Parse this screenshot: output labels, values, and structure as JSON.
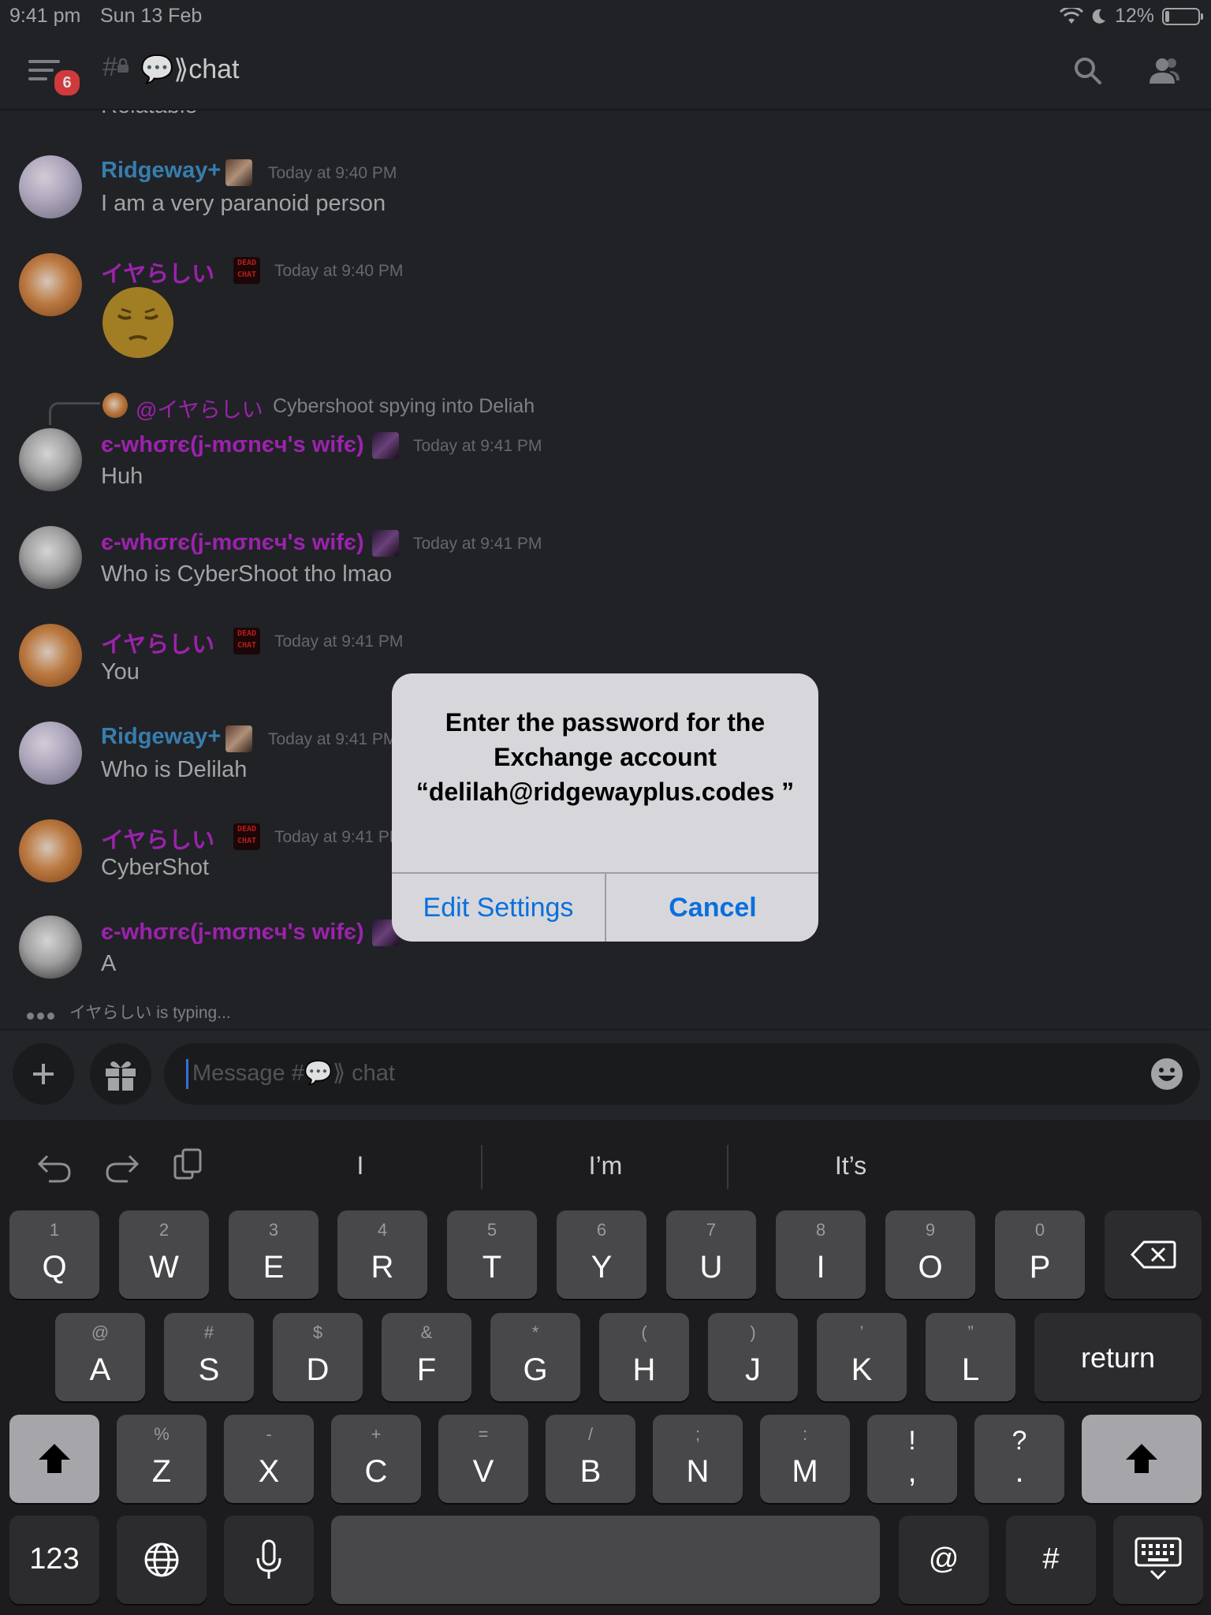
{
  "status_bar": {
    "time": "9:41 pm",
    "date": "Sun 13 Feb",
    "battery_text": "12%",
    "battery_level": 0.12
  },
  "header": {
    "badge_count": "6",
    "channel_name": "💬⟫chat"
  },
  "messages_partial_top": "Relatable",
  "messages": [
    {
      "username": "Ridgeway+",
      "timestamp": "Today at 9:40 PM",
      "text": "I am a very paranoid person"
    },
    {
      "username": "イヤらしい",
      "timestamp": "Today at 9:40 PM",
      "text": "😔"
    },
    {
      "reply_to": "@イヤらしい",
      "reply_text": "Cybershoot spying into Deliah",
      "username": "є-whσrє(j-mσnєч's wifє)",
      "timestamp": "Today at 9:41 PM",
      "text": "Huh"
    },
    {
      "username": "є-whσrє(j-mσnєч's wifє)",
      "timestamp": "Today at 9:41 PM",
      "text": "Who is CyberShoot tho lmao"
    },
    {
      "username": "イヤらしい",
      "timestamp": "Today at 9:41 PM",
      "text": "You"
    },
    {
      "username": "Ridgeway+",
      "timestamp": "Today at 9:41 PM",
      "text": "Who is Delilah"
    },
    {
      "username": "イヤらしい",
      "timestamp": "Today at 9:41 PM",
      "text": "CyberShot"
    },
    {
      "username": "є-whσrє(j-mσnєч's wifє)",
      "timestamp": "",
      "text": "A"
    }
  ],
  "role_badge_text": "DEAD CHAT",
  "typing": {
    "text": "イヤらしい is typing..."
  },
  "composer": {
    "placeholder": "Message #💬⟫ chat"
  },
  "alert": {
    "title": "Enter the password for the Exchange account “delilah@ridgewayplus.codes ”",
    "edit_settings": "Edit Settings",
    "cancel": "Cancel"
  },
  "keyboard": {
    "suggestions": [
      "I",
      "I’m",
      "It’s"
    ],
    "row1": [
      {
        "sub": "1",
        "main": "Q"
      },
      {
        "sub": "2",
        "main": "W"
      },
      {
        "sub": "3",
        "main": "E"
      },
      {
        "sub": "4",
        "main": "R"
      },
      {
        "sub": "5",
        "main": "T"
      },
      {
        "sub": "6",
        "main": "Y"
      },
      {
        "sub": "7",
        "main": "U"
      },
      {
        "sub": "8",
        "main": "I"
      },
      {
        "sub": "9",
        "main": "O"
      },
      {
        "sub": "0",
        "main": "P"
      }
    ],
    "row2": [
      {
        "sub": "@",
        "main": "A"
      },
      {
        "sub": "#",
        "main": "S"
      },
      {
        "sub": "$",
        "main": "D"
      },
      {
        "sub": "&",
        "main": "F"
      },
      {
        "sub": "*",
        "main": "G"
      },
      {
        "sub": "(",
        "main": "H"
      },
      {
        "sub": ")",
        "main": "J"
      },
      {
        "sub": "’",
        "main": "K"
      },
      {
        "sub": "”",
        "main": "L"
      }
    ],
    "row3": [
      {
        "sub": "%",
        "main": "Z"
      },
      {
        "sub": "-",
        "main": "X"
      },
      {
        "sub": "+",
        "main": "C"
      },
      {
        "sub": "=",
        "main": "V"
      },
      {
        "sub": "/",
        "main": "B"
      },
      {
        "sub": ";",
        "main": "N"
      },
      {
        "sub": ":",
        "main": "M"
      },
      {
        "sub": "!",
        "main": ","
      },
      {
        "sub": "?",
        "main": "."
      }
    ],
    "return_label": "return",
    "numbers_label": "123",
    "at_label": "@",
    "hash_label": "#"
  }
}
